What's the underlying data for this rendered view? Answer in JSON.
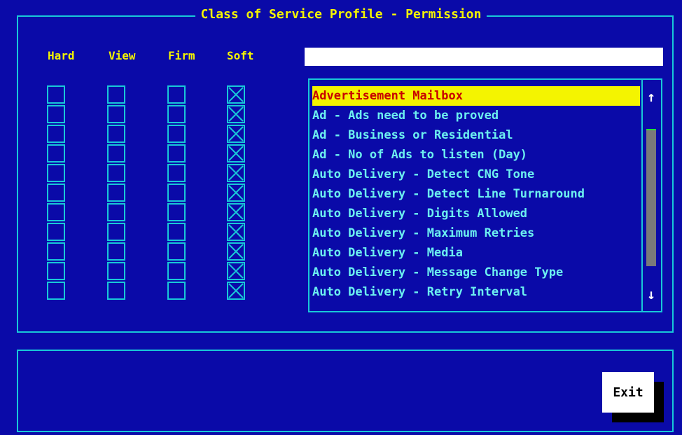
{
  "window": {
    "title": "Class of Service Profile - Permission"
  },
  "columns": {
    "hard": "Hard",
    "view": "View",
    "firm": "Firm",
    "soft": "Soft"
  },
  "search": {
    "value": ""
  },
  "permissions": {
    "hard": [
      false,
      false,
      false,
      false,
      false,
      false,
      false,
      false,
      false,
      false,
      false
    ],
    "view": [
      false,
      false,
      false,
      false,
      false,
      false,
      false,
      false,
      false,
      false,
      false
    ],
    "firm": [
      false,
      false,
      false,
      false,
      false,
      false,
      false,
      false,
      false,
      false,
      false
    ],
    "soft": [
      true,
      true,
      true,
      true,
      true,
      true,
      true,
      true,
      true,
      true,
      true
    ]
  },
  "list": {
    "selected_index": 0,
    "items": [
      "Advertisement Mailbox",
      "Ad - Ads need to be proved",
      "Ad - Business or Residential",
      "Ad - No of Ads to listen (Day)",
      "Auto Delivery - Detect CNG Tone",
      "Auto Delivery - Detect Line Turnaround",
      "Auto Delivery - Digits Allowed",
      "Auto Delivery - Maximum Retries",
      "Auto Delivery - Media",
      "Auto Delivery - Message Change Type",
      "Auto Delivery - Retry Interval"
    ]
  },
  "scrollbar": {
    "up_icon": "arrow-up-icon",
    "up_glyph": "↑",
    "down_icon": "arrow-down-icon",
    "down_glyph": "↓"
  },
  "buttons": {
    "exit_label": "Exit"
  },
  "colors": {
    "background": "#0a0aa8",
    "border": "#18c8d8",
    "heading": "#f4f400",
    "list_text": "#6cf0f0",
    "selected_bg": "#f4f400",
    "selected_text": "#c80000"
  }
}
